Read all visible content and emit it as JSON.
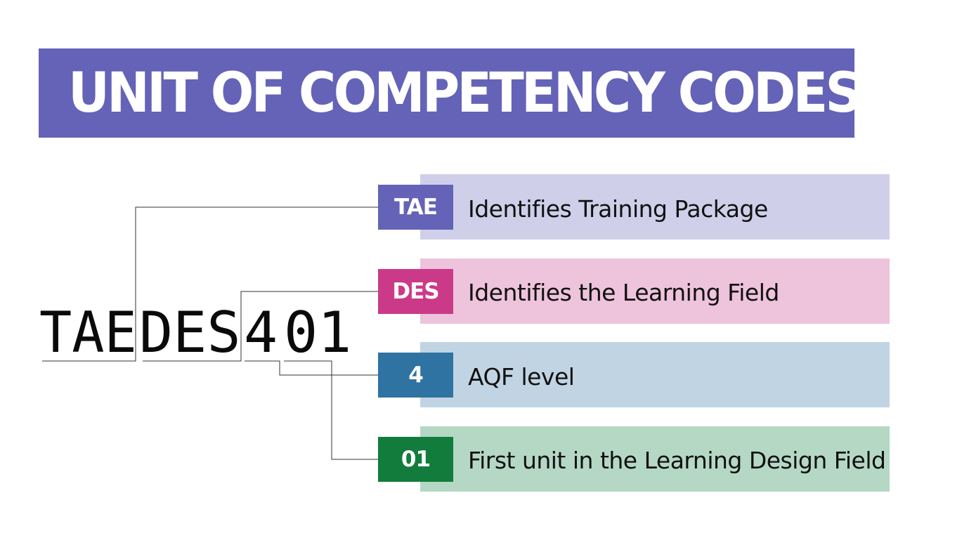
{
  "title": "UNIT OF COMPETENCY CODES",
  "code": {
    "full": "TAEDES401",
    "segments": [
      "TAE",
      "DES",
      "4",
      "01"
    ]
  },
  "rows": [
    {
      "badge": "TAE",
      "description": "Identifies Training Package",
      "badge_color": "#6463b8",
      "band_color": "#d0cfea"
    },
    {
      "badge": "DES",
      "description": "Identifies the Learning Field",
      "badge_color": "#cb3a89",
      "band_color": "#eec3dc"
    },
    {
      "badge": "4",
      "description": "AQF level",
      "badge_color": "#2e73a1",
      "band_color": "#c1d4e3"
    },
    {
      "badge": "01",
      "description": "First unit in the Learning Design Field",
      "badge_color": "#117c3b",
      "band_color": "#b4d8c4"
    }
  ],
  "colors": {
    "banner": "#6463b8",
    "connector": "#333333"
  }
}
